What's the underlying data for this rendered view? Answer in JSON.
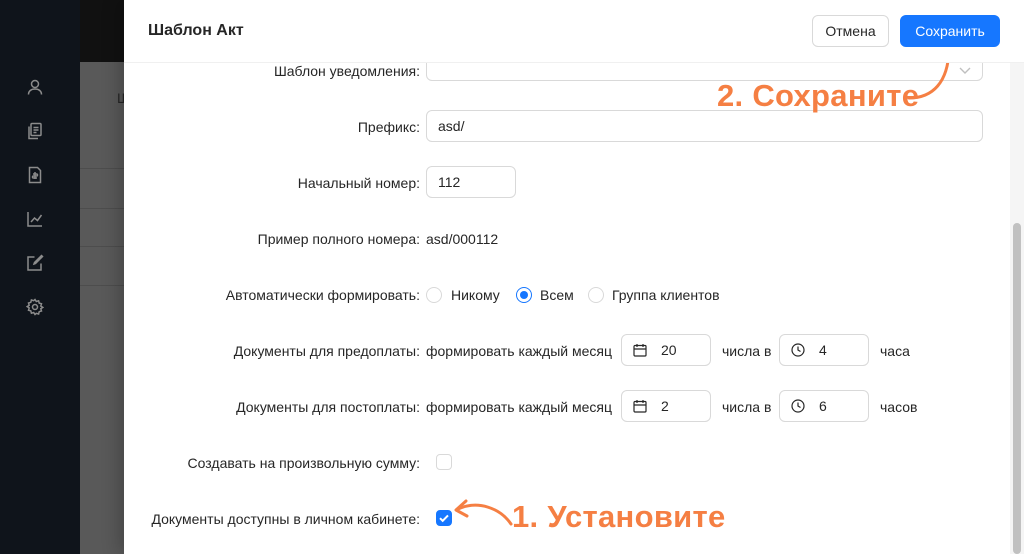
{
  "drawer": {
    "title": "Шаблон Акт",
    "cancel_label": "Отмена",
    "save_label": "Сохранить"
  },
  "backdrop": {
    "partial_text": "Ш"
  },
  "form": {
    "notification_template": {
      "label": "Шаблон уведомления:",
      "value": ""
    },
    "prefix": {
      "label": "Префикс:",
      "value": "asd/"
    },
    "start_number": {
      "label": "Начальный номер:",
      "value": "112"
    },
    "example_number": {
      "label": "Пример полного номера:",
      "value": "asd/000112"
    },
    "auto_generate": {
      "label": "Автоматически формировать:",
      "options": [
        "Никому",
        "Всем",
        "Группа клиентов"
      ],
      "selected": "Всем"
    },
    "prepayment": {
      "label": "Документы для предоплаты:",
      "prefix_text": "формировать каждый месяц",
      "day": "20",
      "middle_text": "числа в",
      "hour": "4",
      "suffix_text": "часа"
    },
    "postpayment": {
      "label": "Документы для постоплаты:",
      "prefix_text": "формировать каждый месяц",
      "day": "2",
      "middle_text": "числа в",
      "hour": "6",
      "suffix_text": "часов"
    },
    "arbitrary_amount": {
      "label": "Создавать на произвольную сумму:",
      "checked": false
    },
    "personal_cabinet": {
      "label": "Документы доступны в личном кабинете:",
      "checked": true
    }
  },
  "annotations": {
    "step1": "1. Установите",
    "step2": "2. Сохраните",
    "color": "#f57f43"
  },
  "sidebar": {
    "icons": [
      "user-icon",
      "copy-documents-icon",
      "invoice-icon",
      "line-chart-icon",
      "edit-square-icon",
      "settings-icon"
    ]
  },
  "colors": {
    "primary": "#1677ff",
    "sidebar": "#0f141b",
    "annotation": "#f57f43"
  }
}
